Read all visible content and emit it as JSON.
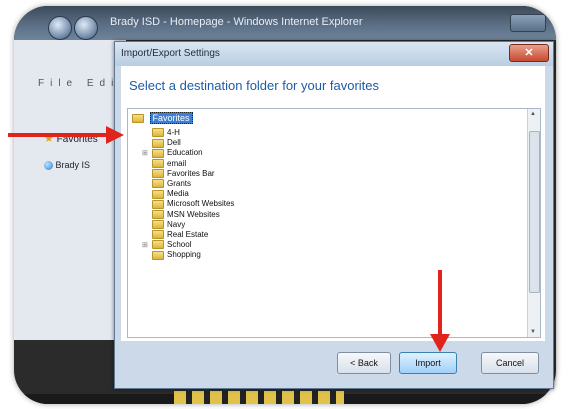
{
  "browser": {
    "window_title": "Brady ISD - Homepage - Windows Internet Explorer",
    "menu": "File Edit",
    "favorites_label": "Favorites",
    "tab_label": "Brady IS"
  },
  "dialog": {
    "title": "Import/Export Settings",
    "close_symbol": "✕",
    "heading": "Select a destination folder for your favorites",
    "tree": {
      "root": "Favorites",
      "items": [
        {
          "label": "4-H",
          "expandable": false
        },
        {
          "label": "Dell",
          "expandable": false
        },
        {
          "label": "Education",
          "expandable": true
        },
        {
          "label": "email",
          "expandable": false
        },
        {
          "label": "Favorites Bar",
          "expandable": false
        },
        {
          "label": "Grants",
          "expandable": false
        },
        {
          "label": "Media",
          "expandable": false
        },
        {
          "label": "Microsoft Websites",
          "expandable": false
        },
        {
          "label": "MSN Websites",
          "expandable": false
        },
        {
          "label": "Navy",
          "expandable": false
        },
        {
          "label": "Real Estate",
          "expandable": false
        },
        {
          "label": "School",
          "expandable": true
        },
        {
          "label": "Shopping",
          "expandable": false
        }
      ]
    },
    "buttons": {
      "back": "< Back",
      "import": "Import",
      "cancel": "Cancel"
    }
  },
  "annotations": {
    "arrow_color": "#e0231b"
  },
  "icons": [
    "folder-icon",
    "star-icon",
    "globe-icon",
    "close-icon",
    "expand-icon"
  ]
}
